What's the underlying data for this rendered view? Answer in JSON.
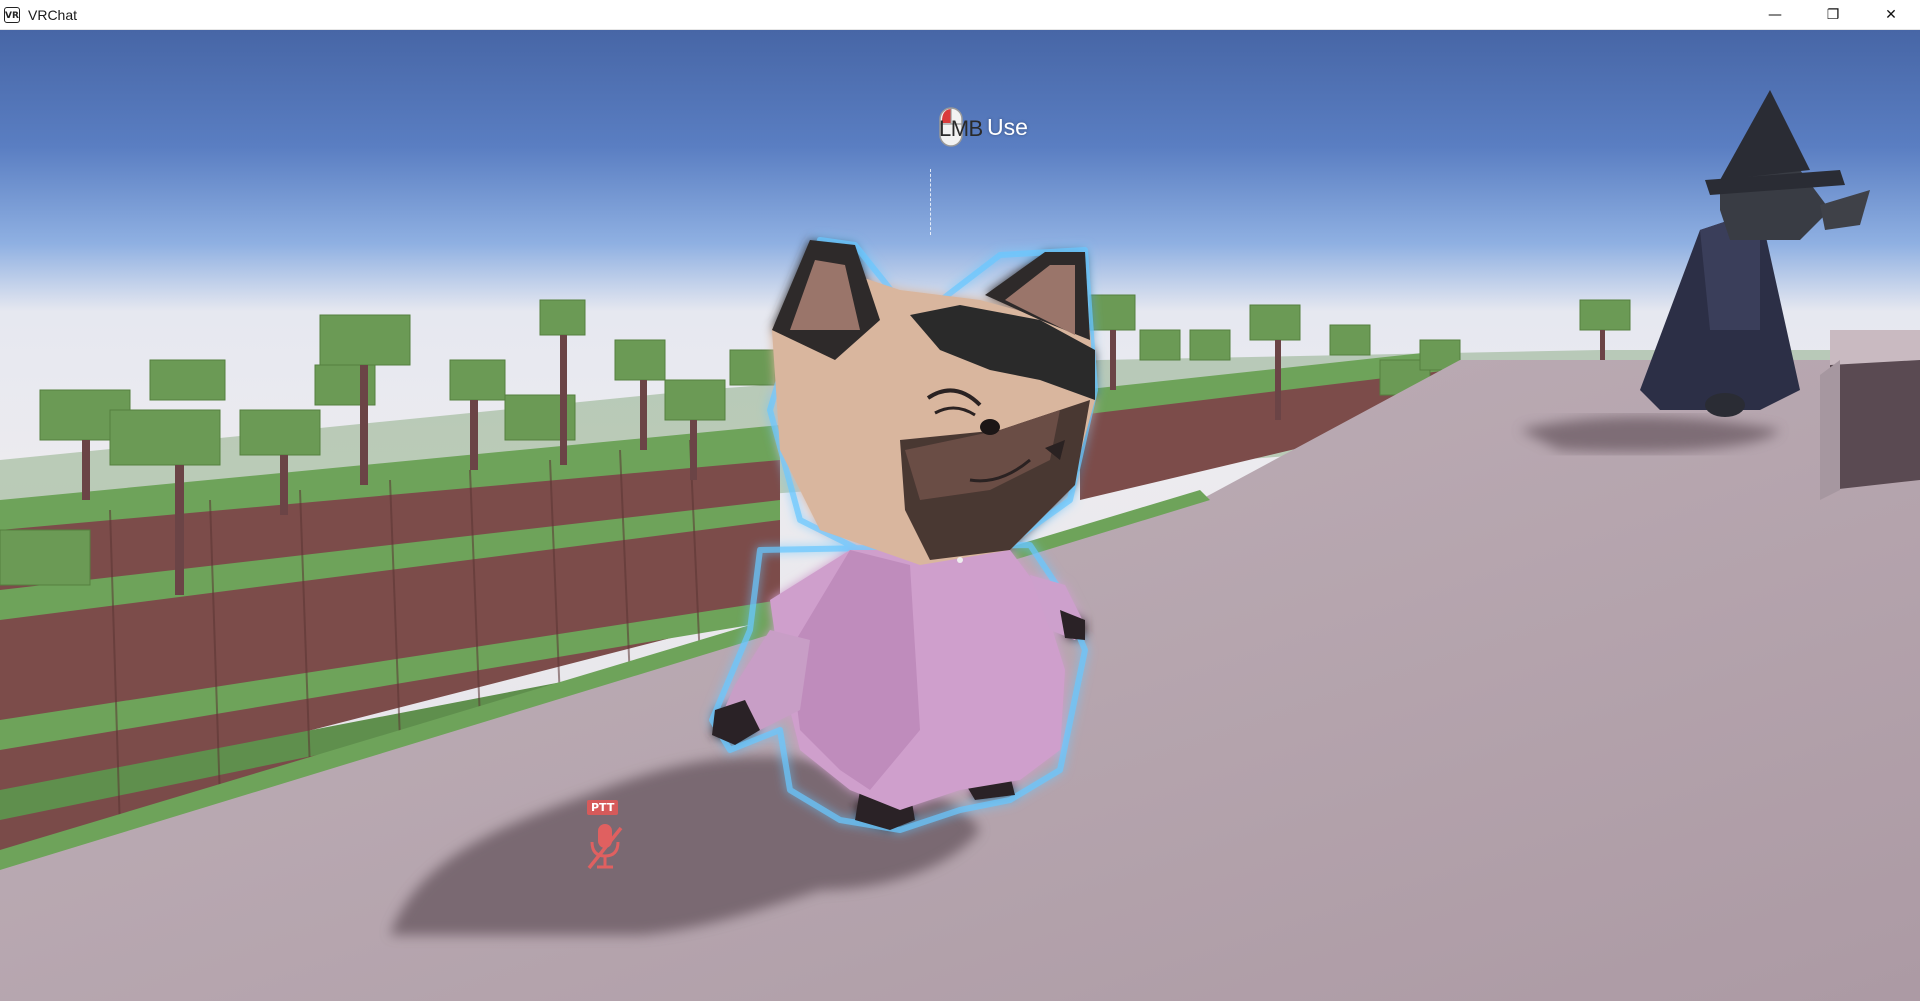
{
  "window": {
    "title": "VRChat",
    "icon_label": "VR",
    "controls": {
      "minimize": "—",
      "restore": "❐",
      "close": "✕"
    }
  },
  "hud": {
    "interact_key": "LMB",
    "interact_action": "Use",
    "ptt_label": "PTT",
    "mic_status": "muted"
  },
  "colors": {
    "sky_top": "#4a6aa8",
    "horizon": "#eae9ee",
    "ground": "#b8a6ae",
    "grass": "#6ea35a",
    "dirt": "#7c4c4a",
    "cat_dress": "#cf9fcc",
    "cat_fur": "#d9b69e",
    "outline_glow": "#69c8ff",
    "mic_muted": "#e06060"
  }
}
